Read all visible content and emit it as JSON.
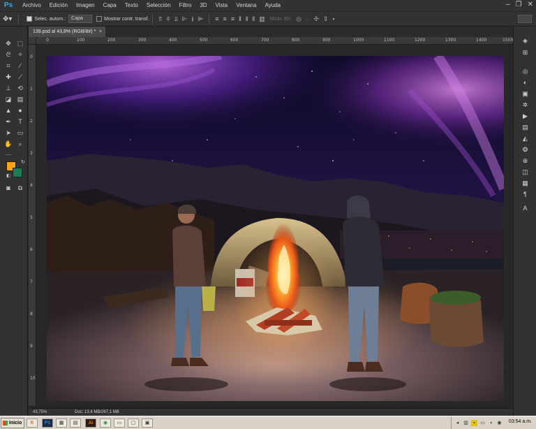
{
  "menu": [
    "Archivo",
    "Edición",
    "Imagen",
    "Capa",
    "Texto",
    "Selección",
    "Filtro",
    "3D",
    "Vista",
    "Ventana",
    "Ayuda"
  ],
  "app_logo": "Ps",
  "options": {
    "auto_select_label": "Selec. autom.:",
    "auto_select_value": "Capa",
    "transform_label": "Mostrar contr. transf.",
    "mode3d_label": "Modo 3D:"
  },
  "document": {
    "tab_title": "139.psd al 43,8% (RGB/8#) *",
    "close_glyph": "×"
  },
  "status": {
    "zoom": "43,75%",
    "doc_info": "Doc: 13,4 MB/267,1 MB"
  },
  "taskbar": {
    "start_label": "Inicio",
    "clock": "03:54 a.m.",
    "items": [
      "B",
      "Ps",
      "▦",
      "▤",
      "Ai",
      "◉",
      "▭",
      "▢",
      "▣"
    ]
  },
  "ruler": {
    "top": [
      "0",
      "100",
      "200",
      "300",
      "400",
      "500",
      "600",
      "700",
      "800",
      "900",
      "1000",
      "1100",
      "1200",
      "1300",
      "1400",
      "1500"
    ],
    "left": [
      "0",
      "1",
      "2",
      "3",
      "4",
      "5",
      "6",
      "7",
      "8",
      "9",
      "10"
    ]
  },
  "colors": {
    "foreground": "#f5a319",
    "background": "#1d7a52",
    "accent": "#31a8ff"
  },
  "icons": {
    "move": "move-icon",
    "marquee": "marquee-icon",
    "lasso": "lasso-icon",
    "magic_wand": "magic-wand-icon",
    "crop": "crop-icon",
    "eyedropper": "eyedropper-icon",
    "healing": "healing-brush-icon",
    "brush": "brush-icon",
    "stamp": "clone-stamp-icon",
    "history_brush": "history-brush-icon",
    "eraser": "eraser-icon",
    "gradient": "gradient-icon",
    "blur": "blur-icon",
    "dodge": "dodge-icon",
    "pen": "pen-icon",
    "type": "type-icon",
    "path_select": "path-selection-icon",
    "shape": "rectangle-icon",
    "hand": "hand-icon",
    "zoom": "zoom-icon"
  }
}
